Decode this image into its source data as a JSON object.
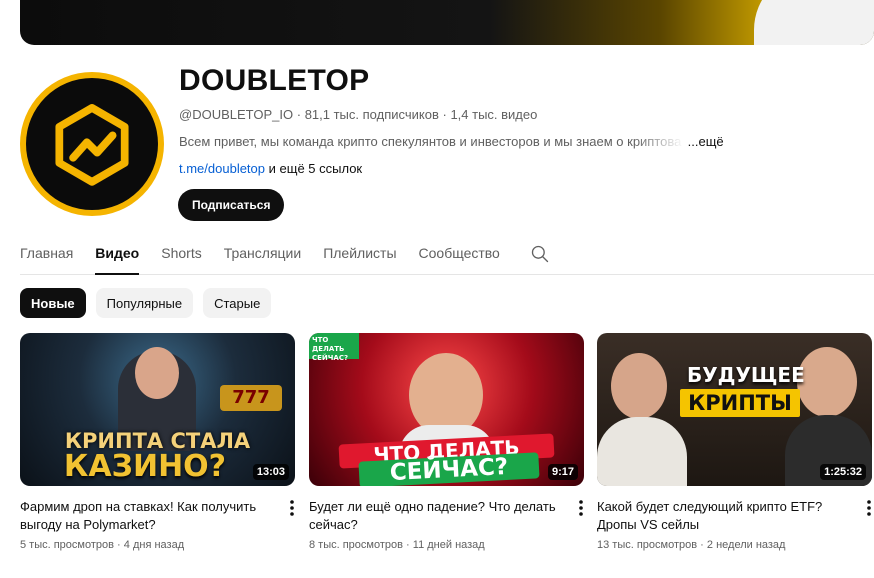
{
  "channel": {
    "name": "DOUBLETOP",
    "handle": "@DOUBLETOP_IO",
    "subscribers": "81,1 тыс. подписчиков",
    "videos": "1,4 тыс. видео",
    "description": "Всем привет, мы команда крипто спекулянтов и инвесторов и мы знаем о криптова",
    "more_label": "...ещё",
    "link": "t.me/doubletop",
    "link_suffix": "и ещё 5 ссылок",
    "subscribe_label": "Подписаться"
  },
  "tabs": [
    "Главная",
    "Видео",
    "Shorts",
    "Трансляции",
    "Плейлисты",
    "Сообщество"
  ],
  "active_tab": "Видео",
  "chips": [
    "Новые",
    "Популярные",
    "Старые"
  ],
  "active_chip": "Новые",
  "videos": [
    {
      "title": "Фармим дроп на ставках! Как получить выгоду на Polymarket?",
      "views": "5 тыс. просмотров",
      "age": "4 дня назад",
      "duration": "13:03",
      "overlay_line1": "КРИПТА СТАЛА",
      "overlay_line2": "КАЗИНО?"
    },
    {
      "title": "Будет ли ещё одно падение? Что делать сейчас?",
      "views": "8 тыс. просмотров",
      "age": "11 дней назад",
      "duration": "9:17",
      "corner_tag": "ЧТО ДЕЛАТЬ СЕЙЧАС?",
      "overlay_line1": "ЧТО ДЕЛАТЬ",
      "overlay_line2": "СЕЙЧАС?"
    },
    {
      "title": "Какой будет следующий крипто ETF? Дропы VS сейлы",
      "views": "13 тыс. просмотров",
      "age": "2 недели назад",
      "duration": "1:25:32",
      "overlay_line1": "БУДУЩЕЕ",
      "overlay_line2": "КРИПТЫ"
    }
  ],
  "colors": {
    "accent_gold": "#f5b400",
    "link_blue": "#065fd4",
    "text_primary": "#0f0f0f",
    "text_secondary": "#606060"
  }
}
